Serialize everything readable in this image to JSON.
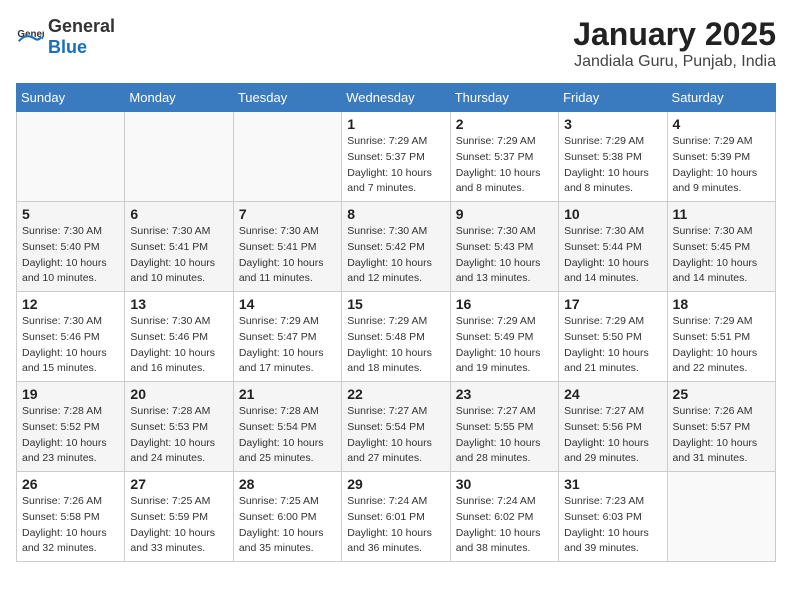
{
  "header": {
    "logo_general": "General",
    "logo_blue": "Blue",
    "title": "January 2025",
    "subtitle": "Jandiala Guru, Punjab, India"
  },
  "weekdays": [
    "Sunday",
    "Monday",
    "Tuesday",
    "Wednesday",
    "Thursday",
    "Friday",
    "Saturday"
  ],
  "weeks": [
    [
      {
        "day": "",
        "sunrise": "",
        "sunset": "",
        "daylight": ""
      },
      {
        "day": "",
        "sunrise": "",
        "sunset": "",
        "daylight": ""
      },
      {
        "day": "",
        "sunrise": "",
        "sunset": "",
        "daylight": ""
      },
      {
        "day": "1",
        "sunrise": "Sunrise: 7:29 AM",
        "sunset": "Sunset: 5:37 PM",
        "daylight": "Daylight: 10 hours and 7 minutes."
      },
      {
        "day": "2",
        "sunrise": "Sunrise: 7:29 AM",
        "sunset": "Sunset: 5:37 PM",
        "daylight": "Daylight: 10 hours and 8 minutes."
      },
      {
        "day": "3",
        "sunrise": "Sunrise: 7:29 AM",
        "sunset": "Sunset: 5:38 PM",
        "daylight": "Daylight: 10 hours and 8 minutes."
      },
      {
        "day": "4",
        "sunrise": "Sunrise: 7:29 AM",
        "sunset": "Sunset: 5:39 PM",
        "daylight": "Daylight: 10 hours and 9 minutes."
      }
    ],
    [
      {
        "day": "5",
        "sunrise": "Sunrise: 7:30 AM",
        "sunset": "Sunset: 5:40 PM",
        "daylight": "Daylight: 10 hours and 10 minutes."
      },
      {
        "day": "6",
        "sunrise": "Sunrise: 7:30 AM",
        "sunset": "Sunset: 5:41 PM",
        "daylight": "Daylight: 10 hours and 10 minutes."
      },
      {
        "day": "7",
        "sunrise": "Sunrise: 7:30 AM",
        "sunset": "Sunset: 5:41 PM",
        "daylight": "Daylight: 10 hours and 11 minutes."
      },
      {
        "day": "8",
        "sunrise": "Sunrise: 7:30 AM",
        "sunset": "Sunset: 5:42 PM",
        "daylight": "Daylight: 10 hours and 12 minutes."
      },
      {
        "day": "9",
        "sunrise": "Sunrise: 7:30 AM",
        "sunset": "Sunset: 5:43 PM",
        "daylight": "Daylight: 10 hours and 13 minutes."
      },
      {
        "day": "10",
        "sunrise": "Sunrise: 7:30 AM",
        "sunset": "Sunset: 5:44 PM",
        "daylight": "Daylight: 10 hours and 14 minutes."
      },
      {
        "day": "11",
        "sunrise": "Sunrise: 7:30 AM",
        "sunset": "Sunset: 5:45 PM",
        "daylight": "Daylight: 10 hours and 14 minutes."
      }
    ],
    [
      {
        "day": "12",
        "sunrise": "Sunrise: 7:30 AM",
        "sunset": "Sunset: 5:46 PM",
        "daylight": "Daylight: 10 hours and 15 minutes."
      },
      {
        "day": "13",
        "sunrise": "Sunrise: 7:30 AM",
        "sunset": "Sunset: 5:46 PM",
        "daylight": "Daylight: 10 hours and 16 minutes."
      },
      {
        "day": "14",
        "sunrise": "Sunrise: 7:29 AM",
        "sunset": "Sunset: 5:47 PM",
        "daylight": "Daylight: 10 hours and 17 minutes."
      },
      {
        "day": "15",
        "sunrise": "Sunrise: 7:29 AM",
        "sunset": "Sunset: 5:48 PM",
        "daylight": "Daylight: 10 hours and 18 minutes."
      },
      {
        "day": "16",
        "sunrise": "Sunrise: 7:29 AM",
        "sunset": "Sunset: 5:49 PM",
        "daylight": "Daylight: 10 hours and 19 minutes."
      },
      {
        "day": "17",
        "sunrise": "Sunrise: 7:29 AM",
        "sunset": "Sunset: 5:50 PM",
        "daylight": "Daylight: 10 hours and 21 minutes."
      },
      {
        "day": "18",
        "sunrise": "Sunrise: 7:29 AM",
        "sunset": "Sunset: 5:51 PM",
        "daylight": "Daylight: 10 hours and 22 minutes."
      }
    ],
    [
      {
        "day": "19",
        "sunrise": "Sunrise: 7:28 AM",
        "sunset": "Sunset: 5:52 PM",
        "daylight": "Daylight: 10 hours and 23 minutes."
      },
      {
        "day": "20",
        "sunrise": "Sunrise: 7:28 AM",
        "sunset": "Sunset: 5:53 PM",
        "daylight": "Daylight: 10 hours and 24 minutes."
      },
      {
        "day": "21",
        "sunrise": "Sunrise: 7:28 AM",
        "sunset": "Sunset: 5:54 PM",
        "daylight": "Daylight: 10 hours and 25 minutes."
      },
      {
        "day": "22",
        "sunrise": "Sunrise: 7:27 AM",
        "sunset": "Sunset: 5:54 PM",
        "daylight": "Daylight: 10 hours and 27 minutes."
      },
      {
        "day": "23",
        "sunrise": "Sunrise: 7:27 AM",
        "sunset": "Sunset: 5:55 PM",
        "daylight": "Daylight: 10 hours and 28 minutes."
      },
      {
        "day": "24",
        "sunrise": "Sunrise: 7:27 AM",
        "sunset": "Sunset: 5:56 PM",
        "daylight": "Daylight: 10 hours and 29 minutes."
      },
      {
        "day": "25",
        "sunrise": "Sunrise: 7:26 AM",
        "sunset": "Sunset: 5:57 PM",
        "daylight": "Daylight: 10 hours and 31 minutes."
      }
    ],
    [
      {
        "day": "26",
        "sunrise": "Sunrise: 7:26 AM",
        "sunset": "Sunset: 5:58 PM",
        "daylight": "Daylight: 10 hours and 32 minutes."
      },
      {
        "day": "27",
        "sunrise": "Sunrise: 7:25 AM",
        "sunset": "Sunset: 5:59 PM",
        "daylight": "Daylight: 10 hours and 33 minutes."
      },
      {
        "day": "28",
        "sunrise": "Sunrise: 7:25 AM",
        "sunset": "Sunset: 6:00 PM",
        "daylight": "Daylight: 10 hours and 35 minutes."
      },
      {
        "day": "29",
        "sunrise": "Sunrise: 7:24 AM",
        "sunset": "Sunset: 6:01 PM",
        "daylight": "Daylight: 10 hours and 36 minutes."
      },
      {
        "day": "30",
        "sunrise": "Sunrise: 7:24 AM",
        "sunset": "Sunset: 6:02 PM",
        "daylight": "Daylight: 10 hours and 38 minutes."
      },
      {
        "day": "31",
        "sunrise": "Sunrise: 7:23 AM",
        "sunset": "Sunset: 6:03 PM",
        "daylight": "Daylight: 10 hours and 39 minutes."
      },
      {
        "day": "",
        "sunrise": "",
        "sunset": "",
        "daylight": ""
      }
    ]
  ]
}
